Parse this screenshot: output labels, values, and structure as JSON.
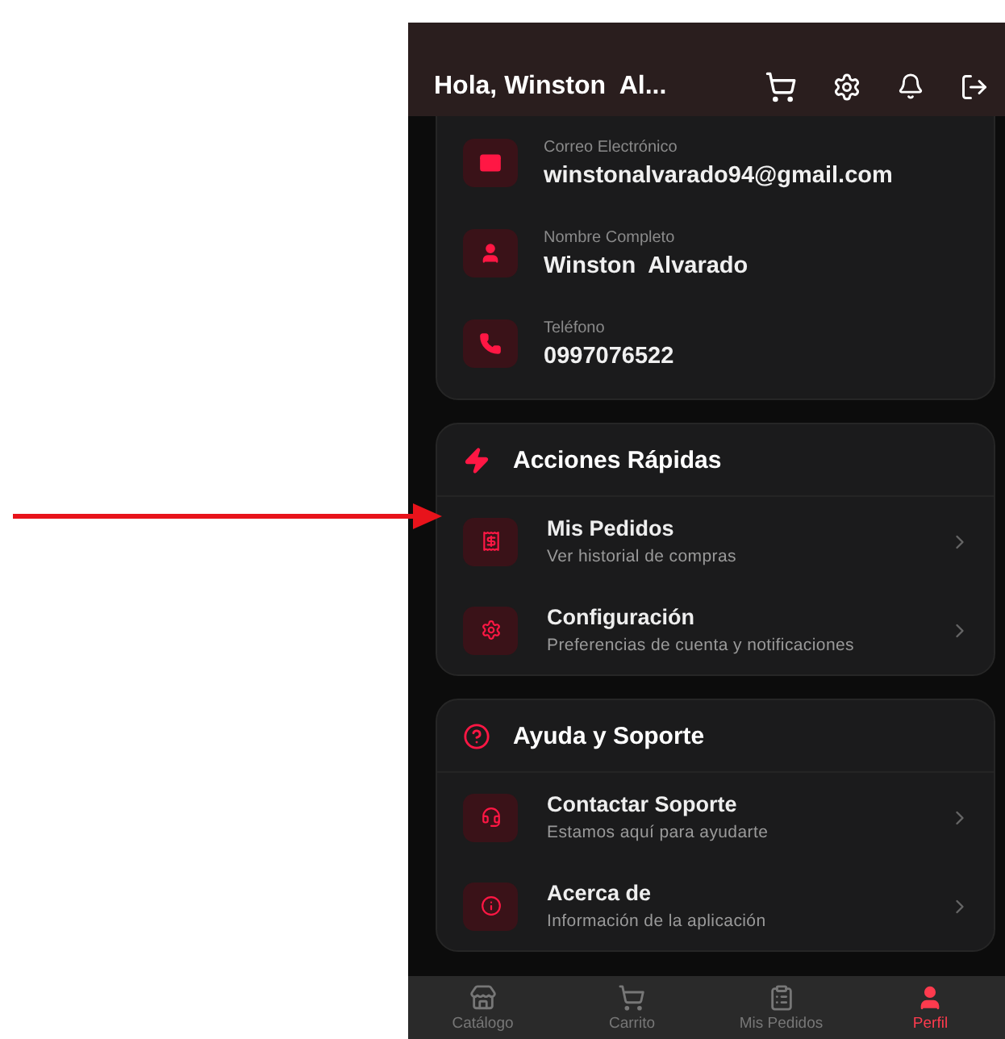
{
  "header": {
    "title": "Hola, Winston  Al..."
  },
  "profile_fields": [
    {
      "label": "Correo Electrónico",
      "value": "winstonalvarado94@gmail.com"
    },
    {
      "label": "Nombre Completo",
      "value": "Winston  Alvarado"
    },
    {
      "label": "Teléfono",
      "value": "0997076522"
    }
  ],
  "sections": [
    {
      "title": "Acciones Rápidas",
      "items": [
        {
          "title": "Mis Pedidos",
          "subtitle": "Ver historial de compras"
        },
        {
          "title": "Configuración",
          "subtitle": "Preferencias de cuenta y notificaciones"
        }
      ]
    },
    {
      "title": "Ayuda y Soporte",
      "items": [
        {
          "title": "Contactar Soporte",
          "subtitle": "Estamos aquí para ayudarte"
        },
        {
          "title": "Acerca de",
          "subtitle": "Información de la aplicación"
        }
      ]
    }
  ],
  "bottom_nav": [
    {
      "label": "Catálogo",
      "selected": false
    },
    {
      "label": "Carrito",
      "selected": false
    },
    {
      "label": "Mis Pedidos",
      "selected": false
    },
    {
      "label": "Perfil",
      "selected": true
    }
  ]
}
